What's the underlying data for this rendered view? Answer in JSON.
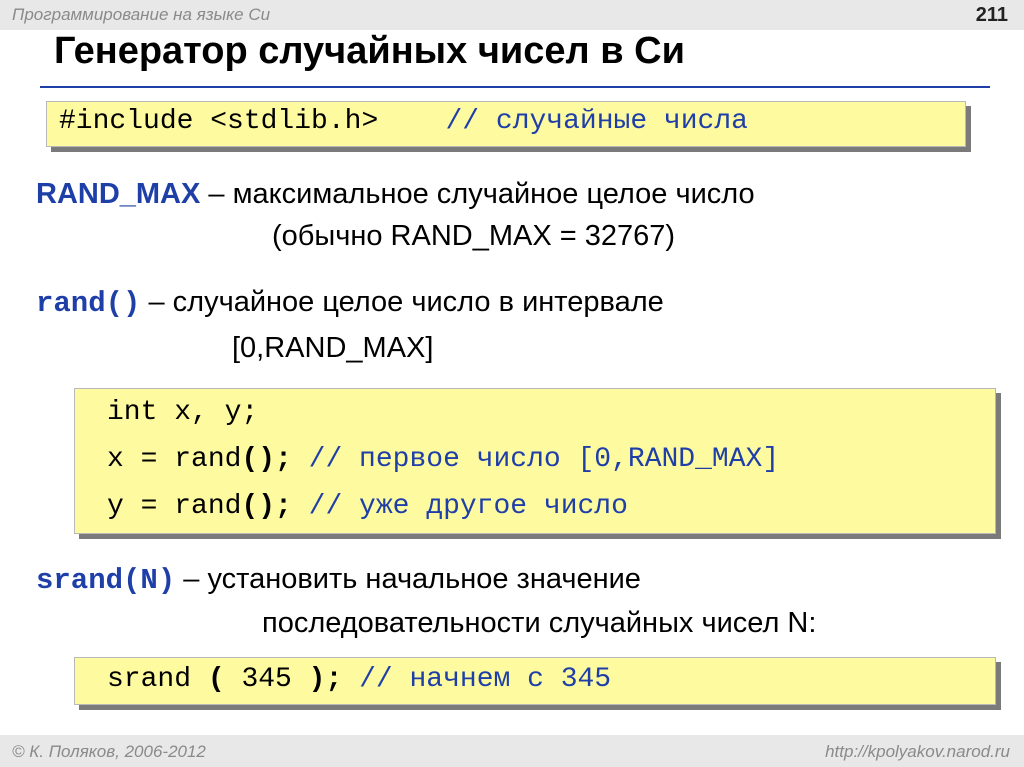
{
  "header": {
    "course": "Программирование на языке Си",
    "slide_number": "211"
  },
  "title": "Генератор случайных чисел в Си",
  "include_box": {
    "code": "#include <stdlib.h>",
    "comment": "// случайные числа"
  },
  "rand_max": {
    "term": "RAND_MAX",
    "desc": " – максимальное случайное целое число",
    "desc2": "(обычно RAND_MAX = 32767)"
  },
  "rand": {
    "term": "rand()",
    "desc": " – случайное целое число в интервале",
    "desc2": "[0,RAND_MAX]"
  },
  "code_box": {
    "line1": "int x, y;",
    "line2_code_a": "x = rand",
    "line2_code_b": "();",
    "line2_comment": " // первое число [0,RAND_MAX]",
    "line3_code_a": "y = rand",
    "line3_code_b": "();",
    "line3_comment": " // уже другое число"
  },
  "srand": {
    "term": "srand(N)",
    "desc": " – установить начальное значение",
    "desc2": "последовательности случайных чисел N:"
  },
  "srand_box": {
    "code_a": "srand ",
    "code_b": "(",
    "code_c": " 345 ",
    "code_d": ");",
    "comment": " // начнем с 345"
  },
  "footer": {
    "copyright": "© К. Поляков, 2006-2012",
    "url": "http://kpolyakov.narod.ru"
  },
  "colors": {
    "code_bg": "#fefaa0",
    "keyword_blue": "#1f3fa8",
    "shadow": "#7a7a7a"
  }
}
